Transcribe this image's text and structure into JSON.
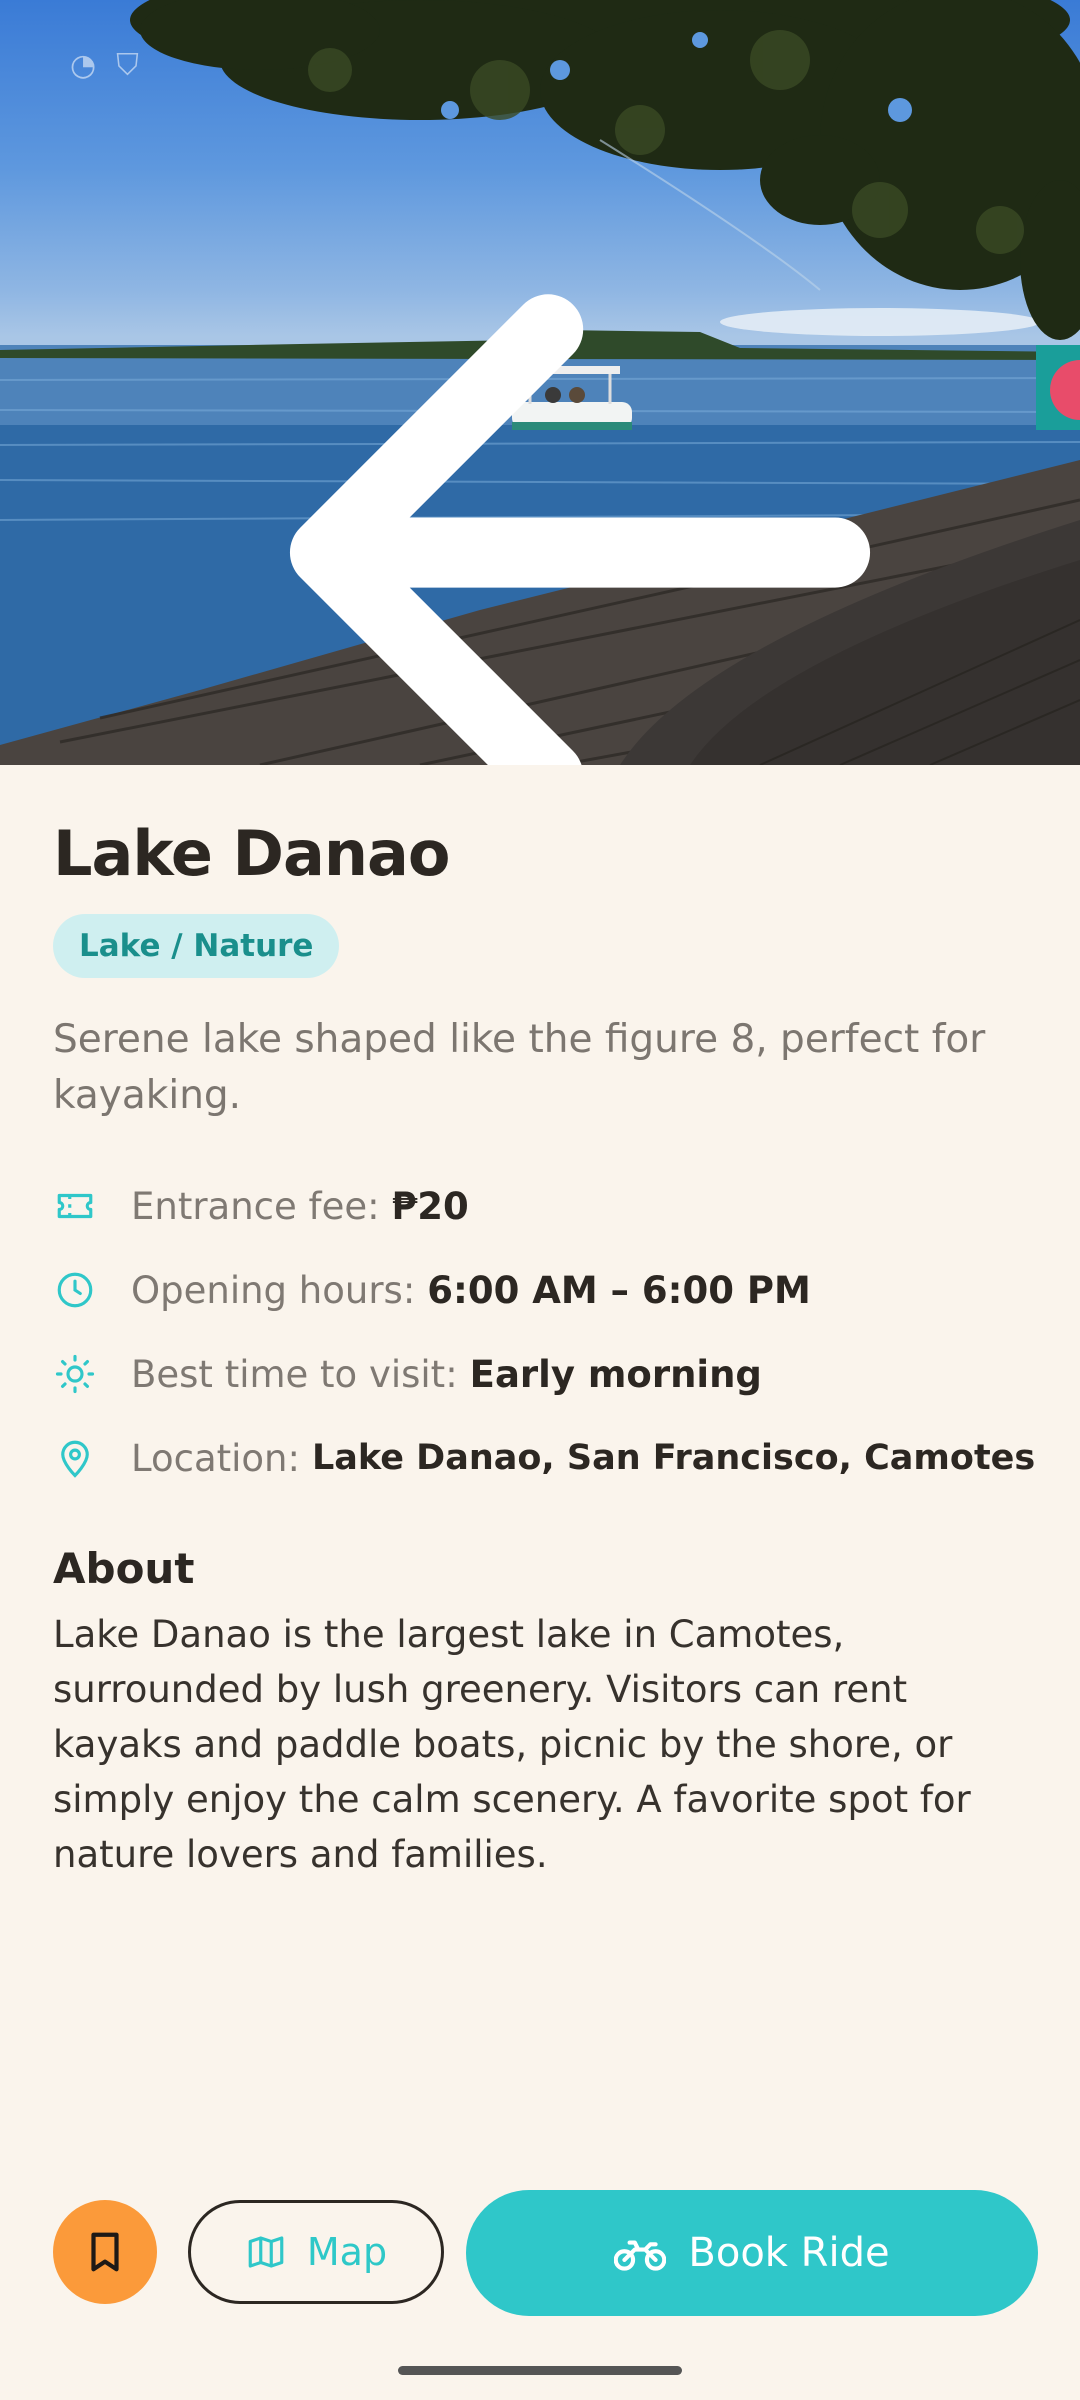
{
  "place": {
    "title": "Lake Danao",
    "category": "Lake / Nature",
    "short_description": "Serene lake shaped like the figure 8, perfect for kayaking."
  },
  "facts": [
    {
      "icon": "ticket-icon",
      "label": "Entrance fee:",
      "value": "₱20"
    },
    {
      "icon": "clock-icon",
      "label": "Opening hours:",
      "value": "6:00 AM – 6:00 PM"
    },
    {
      "icon": "sun-icon",
      "label": "Best time to visit:",
      "value": "Early morning"
    },
    {
      "icon": "location-pin-icon",
      "label": "Location:",
      "value": "Lake Danao, San Francisco, Camotes"
    }
  ],
  "about": {
    "heading": "About",
    "body": "Lake Danao is the largest lake in Camotes, surrounded by lush greenery. Visitors can rent kayaks and paddle boats, picnic by the shore, or simply enjoy the calm scenery. A favorite spot for nature lovers and families."
  },
  "actions": {
    "save_icon": "bookmark-icon",
    "map_label": "Map",
    "book_label": "Book Ride"
  },
  "colors": {
    "accent_teal": "#2fc7c9",
    "tag_bg": "#cfeff0",
    "save_orange": "#fb9a3a",
    "background": "#faf4ec"
  }
}
